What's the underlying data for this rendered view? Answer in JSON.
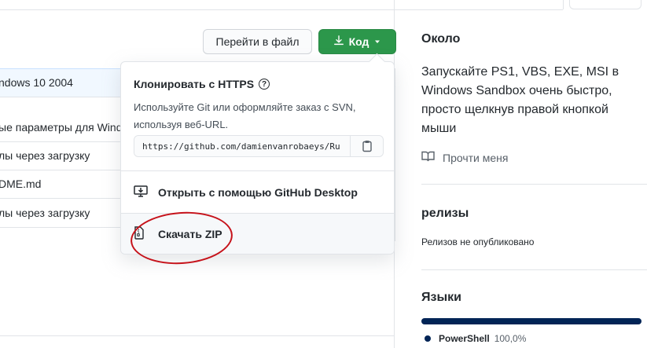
{
  "toolbar": {
    "goto_file_label": "Перейти в файл",
    "code_label": "Код"
  },
  "files": [
    {
      "text": "ndows 10 2004"
    },
    {
      "text": "ые параметры для Wind"
    },
    {
      "text": "лы через загрузку"
    },
    {
      "text": "DME.md"
    },
    {
      "text": "лы через загрузку"
    }
  ],
  "clone": {
    "title": "Клонировать с HTTPS",
    "help_symbol": "?",
    "description": "Используйте Git или оформляйте заказ с SVN, используя веб-URL.",
    "url": "https://github.com/damienvanrobaeys/Ru"
  },
  "menu": {
    "desktop_label": "Открыть с помощью GitHub Desktop",
    "zip_label": "Скачать ZIP"
  },
  "sidebar": {
    "about_heading": "Около",
    "about_text": "Запускайте PS1, VBS, EXE, MSI в Windows Sandbox очень быстро, просто щелкнув правой кнопкой мыши",
    "readme_label": "Прочти меня",
    "releases_heading": "релизы",
    "releases_text": "Релизов не опубликовано",
    "languages_heading": "Языки",
    "languages": [
      {
        "name": "PowerShell",
        "percent": "100,0%",
        "color": "#012456",
        "share": 1.0
      }
    ]
  },
  "colors": {
    "primary_button": "#2c974b",
    "annotation": "#c6121a",
    "powershell": "#012456"
  }
}
